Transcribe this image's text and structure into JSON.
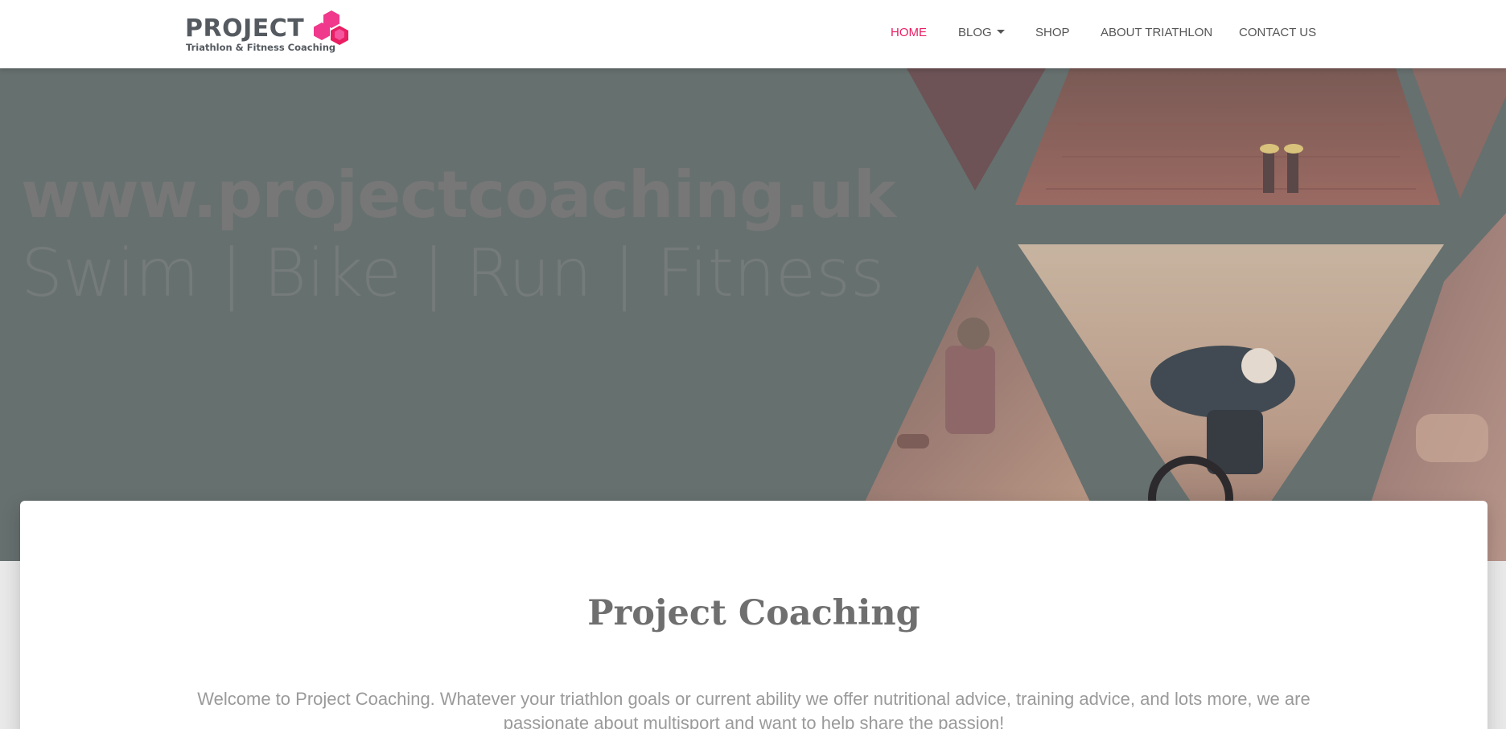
{
  "brand": {
    "name": "PROJECT",
    "tagline": "Triathlon & Fitness Coaching",
    "accent_color": "#e91e63",
    "logo_icon": "hexagon-cluster-icon"
  },
  "nav": {
    "items": [
      {
        "label": "HOME",
        "active": true
      },
      {
        "label": "BLOG",
        "has_dropdown": true
      },
      {
        "label": "SHOP"
      },
      {
        "label": "ABOUT TRIATHLON"
      },
      {
        "label": "CONTACT US"
      }
    ]
  },
  "hero": {
    "title": "www.projectcoaching.uk",
    "subtitle": "Swim | Bike | Run | Fitness",
    "overlay_color": "#66706f"
  },
  "intro": {
    "heading": "Project Coaching",
    "text": "Welcome to Project Coaching. Whatever your triathlon goals or current ability we offer nutritional advice, training advice, and lots more, we are passionate about multisport and want to help share the passion!"
  }
}
